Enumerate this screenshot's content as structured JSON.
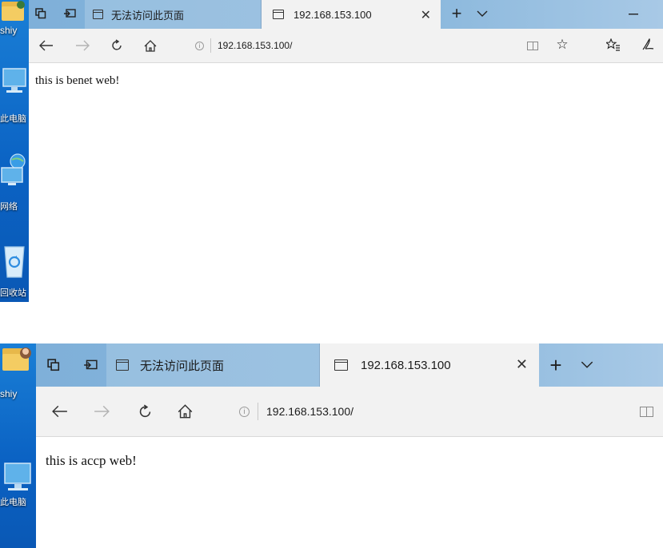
{
  "screenshot_top": {
    "desktop": {
      "icons": [
        {
          "name": "user-folder-icon",
          "label": "shiy"
        },
        {
          "name": "this-pc-icon",
          "label": "此电脑"
        },
        {
          "name": "network-icon",
          "label": "网络"
        },
        {
          "name": "recycle-bin-icon",
          "label": "回收站"
        }
      ]
    },
    "browser": {
      "tabs": [
        {
          "title": "无法访问此页面",
          "active": false
        },
        {
          "title": "192.168.153.100",
          "active": true
        }
      ],
      "address": {
        "url": "192.168.153.100/"
      },
      "page_text": "this is benet web!"
    }
  },
  "screenshot_bottom": {
    "desktop": {
      "icons": [
        {
          "name": "user-folder-icon",
          "label": "shiy"
        },
        {
          "name": "this-pc-icon",
          "label": "此电脑"
        }
      ]
    },
    "browser": {
      "tabs": [
        {
          "title": "无法访问此页面",
          "active": false
        },
        {
          "title": "192.168.153.100",
          "active": true
        }
      ],
      "address": {
        "url": "192.168.153.100/"
      },
      "page_text": "this is accp web!"
    }
  },
  "colors": {
    "desktop_blue": "#0b63c4",
    "tabstrip_blue": "#89b7dc",
    "toolbar_gray": "#f2f2f2"
  }
}
